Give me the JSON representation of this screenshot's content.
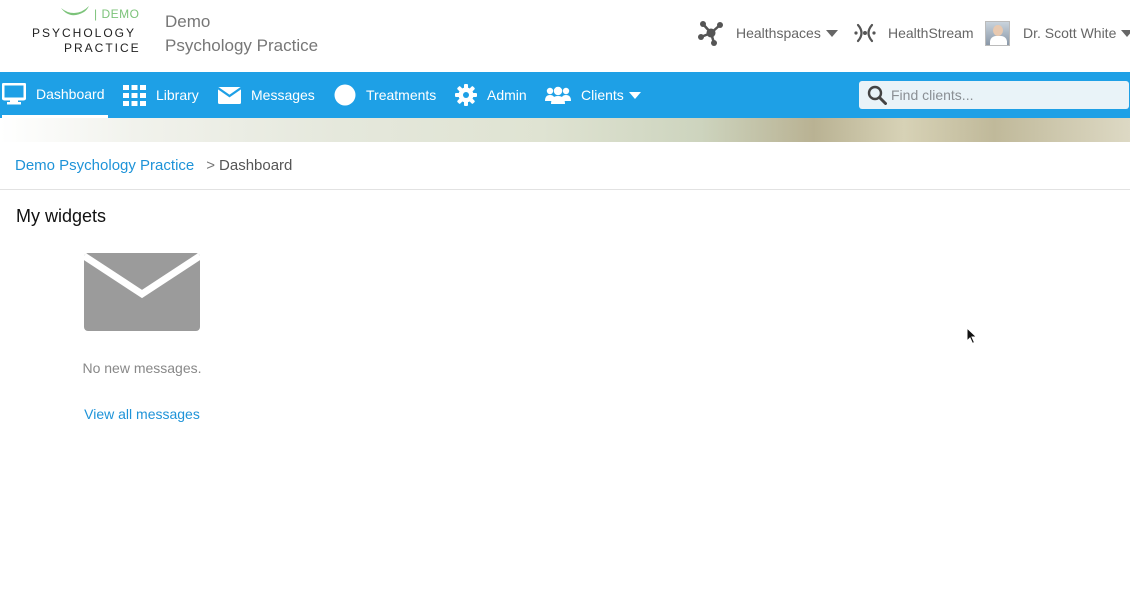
{
  "header": {
    "logo": {
      "demo_tag": "| DEMO",
      "line1": "PSYCHOLOGY",
      "line2": "PRACTICE"
    },
    "practice_title_line1": "Demo",
    "practice_title_line2": "Psychology Practice",
    "healthspaces_label": "Healthspaces",
    "healthstream_label": "HealthStream",
    "user_name": "Dr. Scott White"
  },
  "nav": {
    "items": [
      {
        "label": "Dashboard",
        "icon": "monitor-icon",
        "active": true
      },
      {
        "label": "Library",
        "icon": "grid-icon"
      },
      {
        "label": "Messages",
        "icon": "envelope-icon"
      },
      {
        "label": "Treatments",
        "icon": "circle-icon"
      },
      {
        "label": "Admin",
        "icon": "gear-icon"
      },
      {
        "label": "Clients",
        "icon": "users-icon"
      }
    ],
    "search_placeholder": "Find clients..."
  },
  "breadcrumb": {
    "parent": "Demo Psychology Practice",
    "separator": ">",
    "current": "Dashboard"
  },
  "main": {
    "section_title": "My widgets",
    "messages_widget": {
      "status_text": "No new messages.",
      "link_label": "View all messages"
    }
  },
  "colors": {
    "nav_blue": "#1ea0e6",
    "link_blue": "#1e93d8",
    "logo_green": "#7cc37a",
    "envelope_gray": "#9b9b9b"
  }
}
